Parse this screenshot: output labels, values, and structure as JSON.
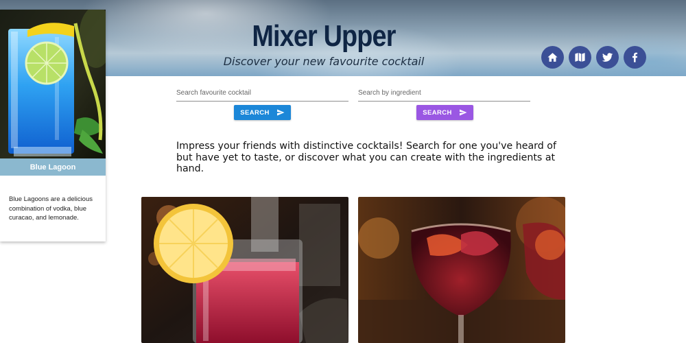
{
  "header": {
    "title": "Mixer Upper",
    "tagline": "Discover your new favourite cocktail",
    "social": [
      {
        "icon": "home-icon"
      },
      {
        "icon": "map-icon"
      },
      {
        "icon": "twitter-icon"
      },
      {
        "icon": "facebook-icon"
      }
    ]
  },
  "featured": {
    "name": "Blue Lagoon",
    "description": "Blue Lagoons are a delicious combination of vodka, blue curacao, and lemonade."
  },
  "search": {
    "cocktail": {
      "placeholder": "Search favourite cocktail",
      "button": "SEARCH"
    },
    "ingredient": {
      "placeholder": "Search by ingredient",
      "button": "SEARCH"
    }
  },
  "intro": "Impress your friends with distinctive cocktails! Search for one you've heard of but have yet to taste, or discover what you can create with the ingredients at hand.",
  "colors": {
    "title": "#0f2544",
    "social_button": "#3b4f96",
    "cocktail_search_button": "#1c87d8",
    "ingredient_search_button": "#9a57e3",
    "card_title_bar": "#8bb8cf"
  }
}
